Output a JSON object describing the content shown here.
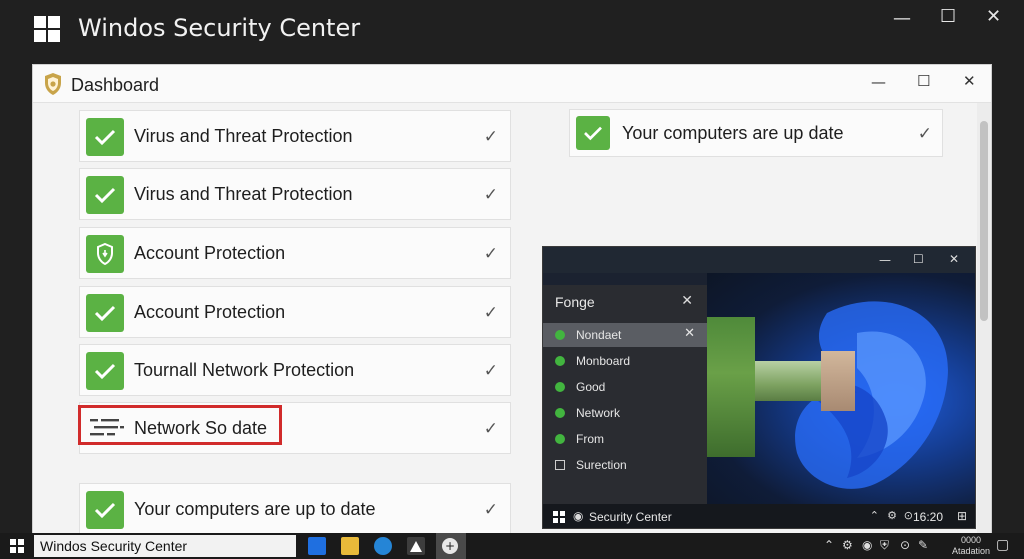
{
  "outer_window": {
    "title": "Windos Security Center"
  },
  "dashboard": {
    "title": "Dashboard",
    "items": [
      {
        "label": "Virus and Threat Protection",
        "icon": "check-icon"
      },
      {
        "label": "Virus and Threat Protection",
        "icon": "check-icon"
      },
      {
        "label": "Account Protection",
        "icon": "shield-icon"
      },
      {
        "label": "Account Protection",
        "icon": "check-icon"
      },
      {
        "label": "Tournall Network Protection",
        "icon": "check-icon"
      },
      {
        "label": "Network So date",
        "icon": "network-lines-icon"
      },
      {
        "label": "Your computers are up to date",
        "icon": "check-icon"
      }
    ],
    "right_item": {
      "label": "Your computers are up date",
      "icon": "check-icon"
    }
  },
  "mini_window": {
    "flyout_title": "Fonge",
    "menu": [
      {
        "label": "Nondaet",
        "selected": true
      },
      {
        "label": "Monboard",
        "selected": false
      },
      {
        "label": "Good",
        "selected": false
      },
      {
        "label": "Network",
        "selected": false
      },
      {
        "label": "From",
        "selected": false
      },
      {
        "label": "Surection",
        "selected": false
      }
    ],
    "taskbar_label": "Security Center",
    "taskbar_time": "16:20"
  },
  "taskbar": {
    "search_text": "Windos Security Center",
    "clock_line1": "0000",
    "clock_line2": "Atadation"
  },
  "colors": {
    "accent_green": "#5bb244",
    "highlight_red": "#d12b2b",
    "wallpaper_blue": "#1f5bd8"
  }
}
